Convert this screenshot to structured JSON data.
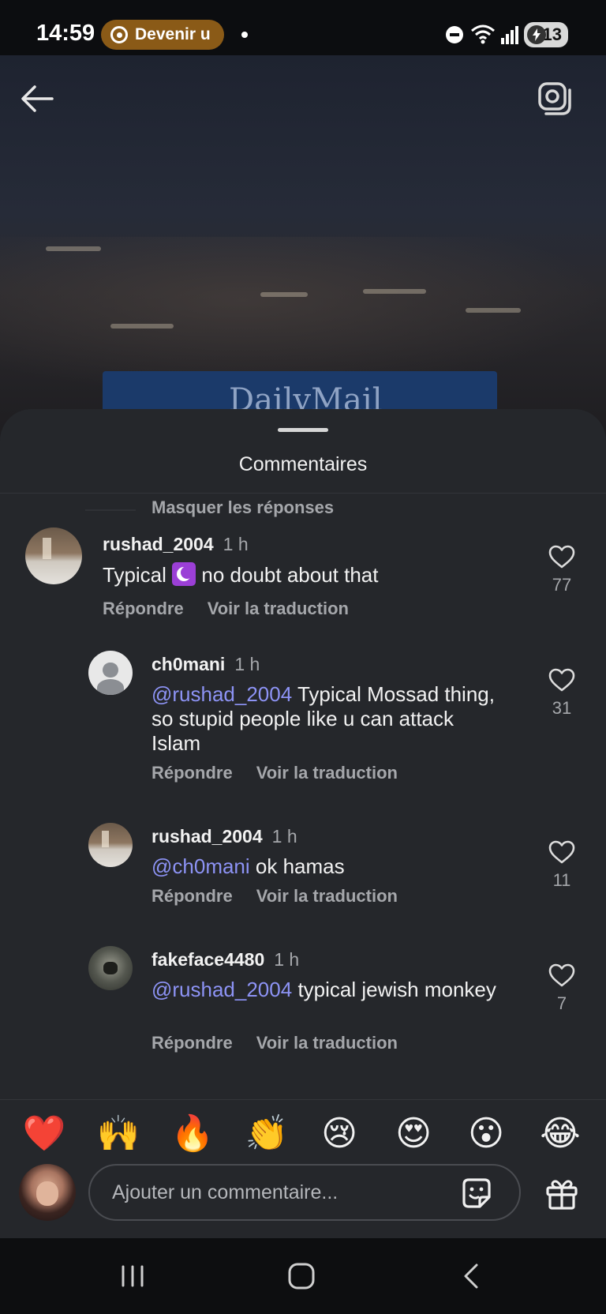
{
  "status_bar": {
    "time": "14:59",
    "pill_label": "Devenir u",
    "battery": "13",
    "pill_color": "#8a5a17"
  },
  "video": {
    "logo_text": "DailyMail"
  },
  "sheet": {
    "title": "Commentaires",
    "hide_replies": "Masquer les réponses"
  },
  "comments": [
    {
      "username": "rushad_2004",
      "time": "1 h",
      "text": "no doubt about that",
      "emoji": "crescent-moon-icon",
      "reply": "Répondre",
      "translate": "Voir la traduction",
      "likes": "77"
    },
    {
      "username": "ch0mani",
      "time": "1 h",
      "mention": "@rushad_2004",
      "text": "Typical Mossad thing, so stupid people like u can attack Islam",
      "reply": "Répondre",
      "translate": "Voir la traduction",
      "likes": "31"
    },
    {
      "username": "rushad_2004",
      "time": "1 h",
      "mention": "@ch0mani",
      "text": "ok hamas",
      "reply": "Répondre",
      "translate": "Voir la traduction",
      "likes": "11"
    },
    {
      "username": "fakeface4480",
      "time": "1 h",
      "mention": "@rushad_2004",
      "text": "typical jewish monkey",
      "reply": "Répondre",
      "translate": "Voir la traduction",
      "likes": "7"
    }
  ],
  "comment_prefix_first": "Typical",
  "reactions": [
    "❤️",
    "🙌",
    "🔥",
    "👏",
    "😢",
    "😍",
    "😮",
    "😂"
  ],
  "composer": {
    "placeholder": "Ajouter un commentaire..."
  },
  "colors": {
    "sheet_bg": "#25272b",
    "mention": "#8d93f5",
    "secondary_text": "#a5a7ab"
  }
}
